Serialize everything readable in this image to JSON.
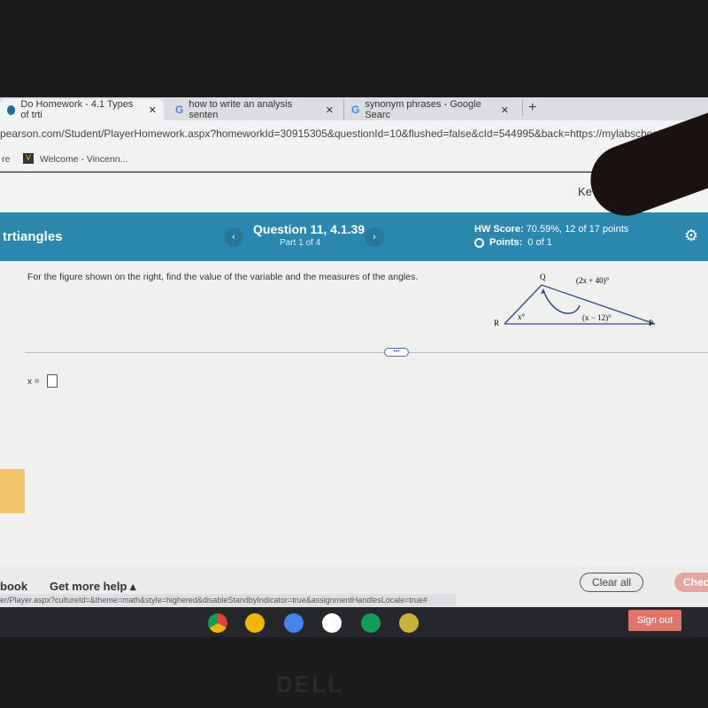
{
  "browser": {
    "tabs": [
      {
        "label": "Do Homework - 4.1 Types of trti",
        "active": true
      },
      {
        "label": "how to write an analysis senten",
        "active": false
      },
      {
        "label": "synonym phrases - Google Searc",
        "active": false
      }
    ],
    "new_tab": "+",
    "close": "✕",
    "url": "pearson.com/Student/PlayerHomework.aspx?homeworkId=30915305&questionId=10&flushed=false&cId=544995&back=https://mylabschool",
    "bookmarks": [
      "re",
      "Welcome - Vincenn..."
    ]
  },
  "page_header": {
    "partial_text": "Ke"
  },
  "header": {
    "assignment": "trtiangles",
    "question": "Question 11, 4.1.39",
    "part": "Part 1 of 4",
    "hw_score_label": "HW Score:",
    "hw_score_value": "70.59%, 12 of 17 points",
    "points_label": "Points:",
    "points_value": "0 of 1"
  },
  "question": {
    "prompt": "For the figure shown on the right, find the value of the variable and the measures of the angles.",
    "figure": {
      "vertices": [
        "Q",
        "R",
        "P"
      ],
      "angle_Q": "(2x + 40)°",
      "angle_R": "x°",
      "angle_P": "(x − 12)°"
    },
    "answer_label": "x =",
    "answer_value": "",
    "handle": "•••"
  },
  "footer": {
    "textbook": "book",
    "help": "Get more help ▴",
    "clear": "Clear all",
    "check": "Chec"
  },
  "status_url": "er/Player.aspx?cultureId=&theme=math&style=highered&disableStandbyIndicator=true&assignmentHandlesLocale=true#",
  "shelf": {
    "apps": [
      "chrome",
      "slides",
      "docs",
      "drive",
      "sheets",
      "classroom"
    ],
    "sign_out": "Sign out"
  },
  "bezel_logo": "DELL"
}
